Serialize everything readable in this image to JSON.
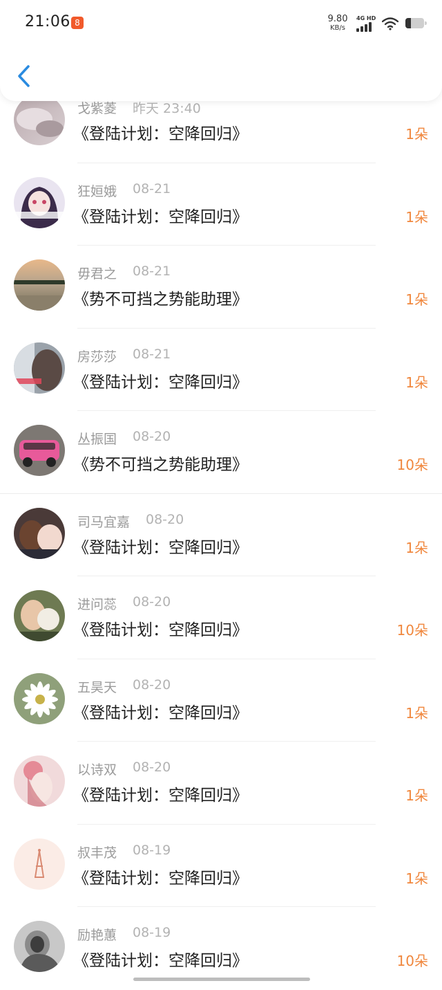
{
  "status_bar": {
    "time": "21:06",
    "app_badge": "8",
    "speed_value": "9.80",
    "speed_unit": "KB/s",
    "network": "4G HD"
  },
  "header": {
    "back_icon": "chevron-left-icon"
  },
  "colors": {
    "count": "#f0873d",
    "accent": "#2a8be0"
  },
  "items": [
    {
      "name": "戈紫菱",
      "date": "昨天 23:40",
      "title": "《登陆计划：空降回归》",
      "count": "1朵"
    },
    {
      "name": "狂姮娥",
      "date": "08-21",
      "title": "《登陆计划：空降回归》",
      "count": "1朵"
    },
    {
      "name": "毋君之",
      "date": "08-21",
      "title": "《势不可挡之势能助理》",
      "count": "1朵"
    },
    {
      "name": "房莎莎",
      "date": "08-21",
      "title": "《登陆计划：空降回归》",
      "count": "1朵"
    },
    {
      "name": "丛振国",
      "date": "08-20",
      "title": "《势不可挡之势能助理》",
      "count": "10朵"
    },
    {
      "name": "司马宜嘉",
      "date": "08-20",
      "title": "《登陆计划：空降回归》",
      "count": "1朵"
    },
    {
      "name": "进问蕊",
      "date": "08-20",
      "title": "《登陆计划：空降回归》",
      "count": "10朵"
    },
    {
      "name": "五昊天",
      "date": "08-20",
      "title": "《登陆计划：空降回归》",
      "count": "1朵"
    },
    {
      "name": "以诗双",
      "date": "08-20",
      "title": "《登陆计划：空降回归》",
      "count": "1朵"
    },
    {
      "name": "叔丰茂",
      "date": "08-19",
      "title": "《登陆计划：空降回归》",
      "count": "1朵"
    },
    {
      "name": "励艳蕙",
      "date": "08-19",
      "title": "《登陆计划：空降回归》",
      "count": "10朵"
    }
  ]
}
